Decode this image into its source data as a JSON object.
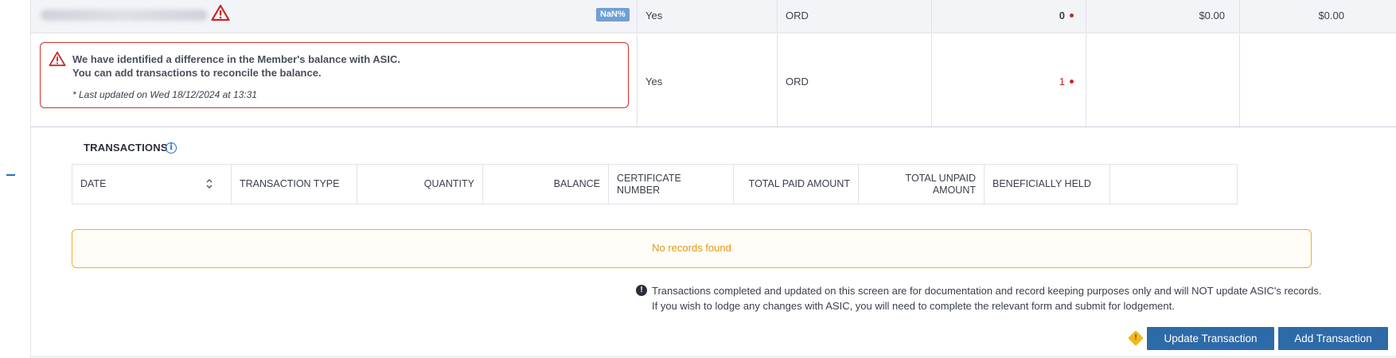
{
  "row1": {
    "badge": "NaN%",
    "col_yes": "Yes",
    "col_class": "ORD",
    "col_qty": "0",
    "col_paid": "$0.00",
    "col_unpaid": "$0.00"
  },
  "row2": {
    "alert_line1": "We have identified a difference in the Member's balance with ASIC.",
    "alert_line2": "You can add transactions to reconcile the balance.",
    "alert_updated": "* Last updated on Wed 18/12/2024 at 13:31",
    "col_yes": "Yes",
    "col_class": "ORD",
    "col_qty": "1"
  },
  "transactions": {
    "title": "TRANSACTIONS",
    "columns": [
      "DATE",
      "TRANSACTION TYPE",
      "QUANTITY",
      "BALANCE",
      "CERTIFICATE NUMBER",
      "TOTAL PAID AMOUNT",
      "TOTAL UNPAID AMOUNT",
      "BENEFICIALLY HELD",
      ""
    ],
    "empty_message": "No records found"
  },
  "notice": {
    "line1": "Transactions completed and updated on this screen are for documentation and record keeping purposes only and will NOT update ASIC's records.",
    "line2": "If you wish to lodge any changes with ASIC, you will need to complete the relevant form and submit for lodgement."
  },
  "buttons": {
    "update": "Update Transaction",
    "add": "Add Transaction"
  },
  "colors": {
    "accent": "#2d6aa8",
    "error": "#d32f2f",
    "warning": "#f0b12a"
  },
  "icons": {
    "row1_status": "warning-triangle-icon",
    "alert": "warning-triangle-icon",
    "title_info": "info-icon",
    "sort": "sort-icon",
    "notice": "exclamation-circle-icon",
    "button_warning": "warning-diamond-icon"
  }
}
